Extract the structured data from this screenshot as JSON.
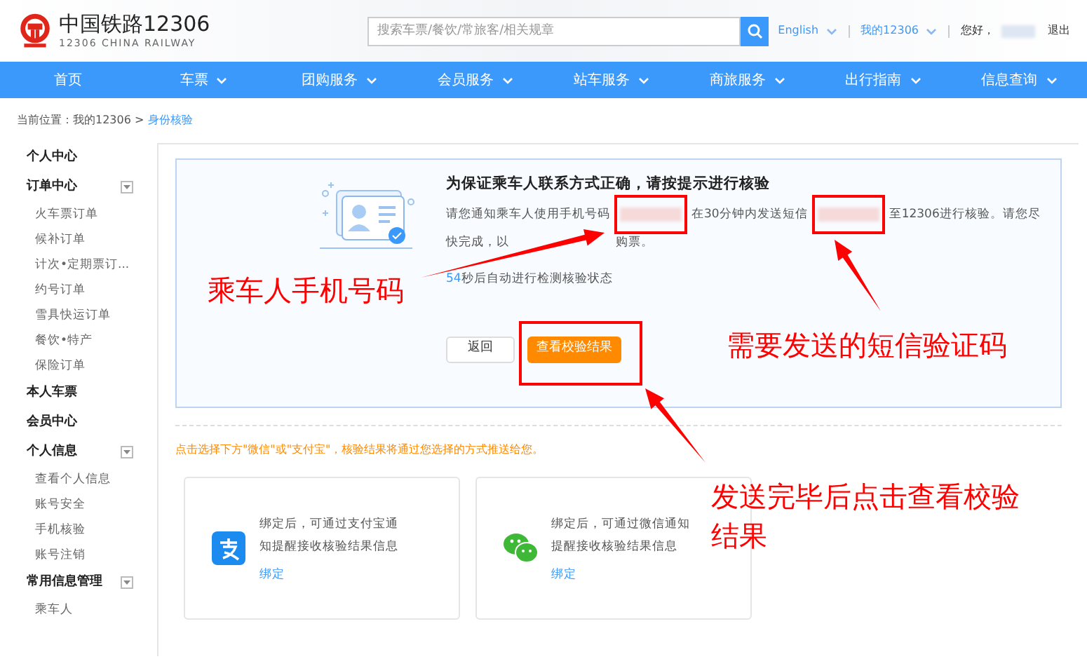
{
  "header": {
    "logo_title": "中国铁路12306",
    "logo_subtitle": "12306 CHINA RAILWAY",
    "search": {
      "placeholder": "搜索车票/餐饮/常旅客/相关规章"
    },
    "links": [
      {
        "label": "English",
        "has_menu": true
      },
      {
        "label": "我的12306",
        "has_menu": true
      }
    ],
    "greeting": "您好，",
    "logout": "退出"
  },
  "nav": [
    {
      "label": "首页",
      "has_menu": false
    },
    {
      "label": "车票",
      "has_menu": true
    },
    {
      "label": "团购服务",
      "has_menu": true
    },
    {
      "label": "会员服务",
      "has_menu": true
    },
    {
      "label": "站车服务",
      "has_menu": true
    },
    {
      "label": "商旅服务",
      "has_menu": true
    },
    {
      "label": "出行指南",
      "has_menu": true
    },
    {
      "label": "信息查询",
      "has_menu": true
    }
  ],
  "breadcrumb": {
    "prefix": "当前位置：我的12306 >",
    "current": "身份核验"
  },
  "sidebar": [
    {
      "label": "个人中心",
      "collapsible": false
    },
    {
      "label": "订单中心",
      "collapsible": true,
      "children": [
        {
          "label": "火车票订单"
        },
        {
          "label": "候补订单"
        },
        {
          "label": "计次•定期票订..."
        },
        {
          "label": "约号订单"
        },
        {
          "label": "雪具快运订单"
        },
        {
          "label": "餐饮•特产"
        },
        {
          "label": "保险订单"
        }
      ]
    },
    {
      "label": "本人车票",
      "collapsible": false
    },
    {
      "label": "会员中心",
      "collapsible": false
    },
    {
      "label": "个人信息",
      "collapsible": true,
      "children": [
        {
          "label": "查看个人信息"
        },
        {
          "label": "账号安全"
        },
        {
          "label": "手机核验"
        },
        {
          "label": "账号注销"
        }
      ]
    },
    {
      "label": "常用信息管理",
      "collapsible": true,
      "children": [
        {
          "label": "乘车人"
        }
      ]
    }
  ],
  "verify": {
    "title": "为保证乘车人联系方式正确，请按提示进行核验",
    "message": [
      {
        "kind": "text",
        "text": "请您通知乘车人使用手机号码"
      },
      {
        "kind": "redacted"
      },
      {
        "kind": "text",
        "text": "在30分钟内发送短信"
      },
      {
        "kind": "redacted"
      },
      {
        "kind": "text",
        "text": "至12306进行核验。请您尽"
      },
      {
        "kind": "break"
      },
      {
        "kind": "text",
        "text": "快完成，以"
      },
      {
        "kind": "gap"
      },
      {
        "kind": "text",
        "text": "购票。"
      }
    ],
    "countdown_seconds": "54",
    "countdown_text": "秒后自动进行检测核验状态",
    "back_button": "返回",
    "check_button": "查看校验结果"
  },
  "notify": {
    "hint": "点击选择下方\"微信\"或\"支付宝\"，核验结果将通过您选择的方式推送给您。",
    "cards": [
      {
        "kind": "alipay",
        "text": "绑定后，可通过支付宝通知提醒接收核验结果信息",
        "link": "绑定"
      },
      {
        "kind": "wechat",
        "text": "绑定后，可通过微信通知提醒接收核验结果信息",
        "link": "绑定"
      }
    ]
  },
  "annotations": [
    {
      "text": "乘车人手机号码"
    },
    {
      "text": "需要发送的短信验证码"
    },
    {
      "text": "发送完毕后点击查看校验结果"
    }
  ]
}
